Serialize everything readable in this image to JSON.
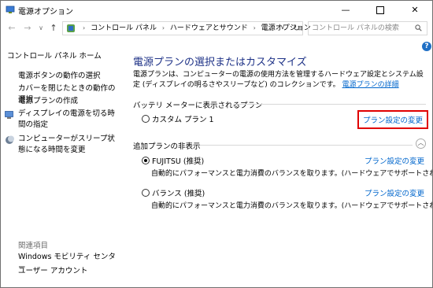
{
  "window": {
    "title": "電源オプション"
  },
  "titlebar": {
    "minimize": "—",
    "close": "✕"
  },
  "address": {
    "crumbs": [
      "コントロール パネル",
      "ハードウェアとサウンド",
      "電源オプション"
    ],
    "search_placeholder": "コントロール パネルの検索"
  },
  "sidebar": {
    "home": "コントロール パネル ホーム",
    "links": [
      "電源ボタンの動作の選択",
      "カバーを閉じたときの動作の選択",
      "電源プランの作成",
      "ディスプレイの電源を切る時間の指定",
      "コンピューターがスリープ状態になる時間を変更"
    ],
    "see_also_heading": "関連項目",
    "see_also": [
      "Windows モビリティ センター",
      "ユーザー アカウント"
    ]
  },
  "main": {
    "title": "電源プランの選択またはカスタマイズ",
    "description": "電源プランは、コンピューターの電源の使用方法を管理するハードウェア設定とシステム設定 (ディスプレイの明るさやスリープなど) のコレクションです。",
    "description_link": "電源プランの詳細",
    "battery_section": "バッテリ メーターに表示されるプラン",
    "additional_section": "追加プランの非表示",
    "plans": [
      {
        "name": "カスタム プラン 1",
        "checked": false,
        "link": "プラン設定の変更",
        "desc": ""
      },
      {
        "name": "FUJITSU (推奨)",
        "checked": true,
        "link": "プラン設定の変更",
        "desc": "自動的にパフォーマンスと電力消費のバランスを取ります。(ハードウェアでサポートされている場合)"
      },
      {
        "name": "バランス (推奨)",
        "checked": false,
        "link": "プラン設定の変更",
        "desc": "自動的にパフォーマンスと電力消費のバランスを取ります。(ハードウェアでサポートされている場合)"
      }
    ]
  },
  "colors": {
    "title_blue": "#1e3287",
    "link_blue": "#0066cc",
    "highlight_red": "#e00000"
  },
  "icons": [
    "control-panel-icon",
    "shield-icon",
    "refresh-icon",
    "search-icon",
    "help-icon",
    "collapse-icon"
  ]
}
